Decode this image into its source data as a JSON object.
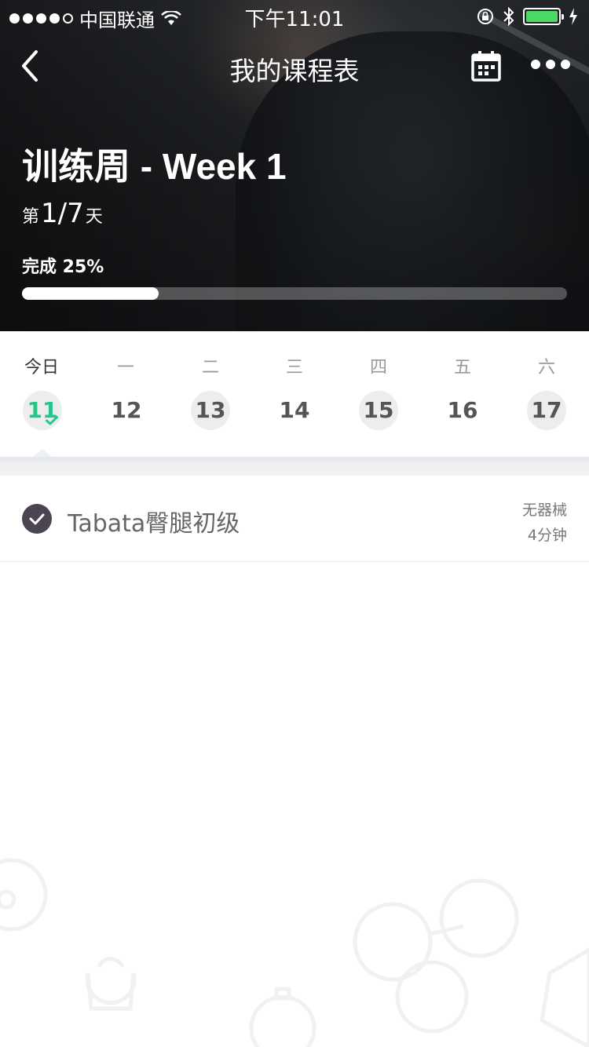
{
  "status_bar": {
    "carrier": "中国联通",
    "time": "下午11:01",
    "battery_color": "#4cd964"
  },
  "nav": {
    "title": "我的课程表",
    "back_icon": "chevron-left-icon",
    "calendar_icon": "calendar-icon",
    "more_icon": "more-dots-icon"
  },
  "hero": {
    "week_title": "训练周 - Week 1",
    "day_prefix": "第",
    "day_value": "1/7",
    "day_suffix": "天",
    "progress_label": "完成 25%",
    "progress": 0.25
  },
  "week": {
    "days": [
      {
        "weekday": "今日",
        "date": "11"
      },
      {
        "weekday": "一",
        "date": "12"
      },
      {
        "weekday": "二",
        "date": "13"
      },
      {
        "weekday": "三",
        "date": "14"
      },
      {
        "weekday": "四",
        "date": "15"
      },
      {
        "weekday": "五",
        "date": "16"
      },
      {
        "weekday": "六",
        "date": "17"
      }
    ],
    "accent_color": "#24c789"
  },
  "courses": [
    {
      "name": "Tabata臀腿初级",
      "equipment": "无器械",
      "duration": "4分钟"
    }
  ]
}
